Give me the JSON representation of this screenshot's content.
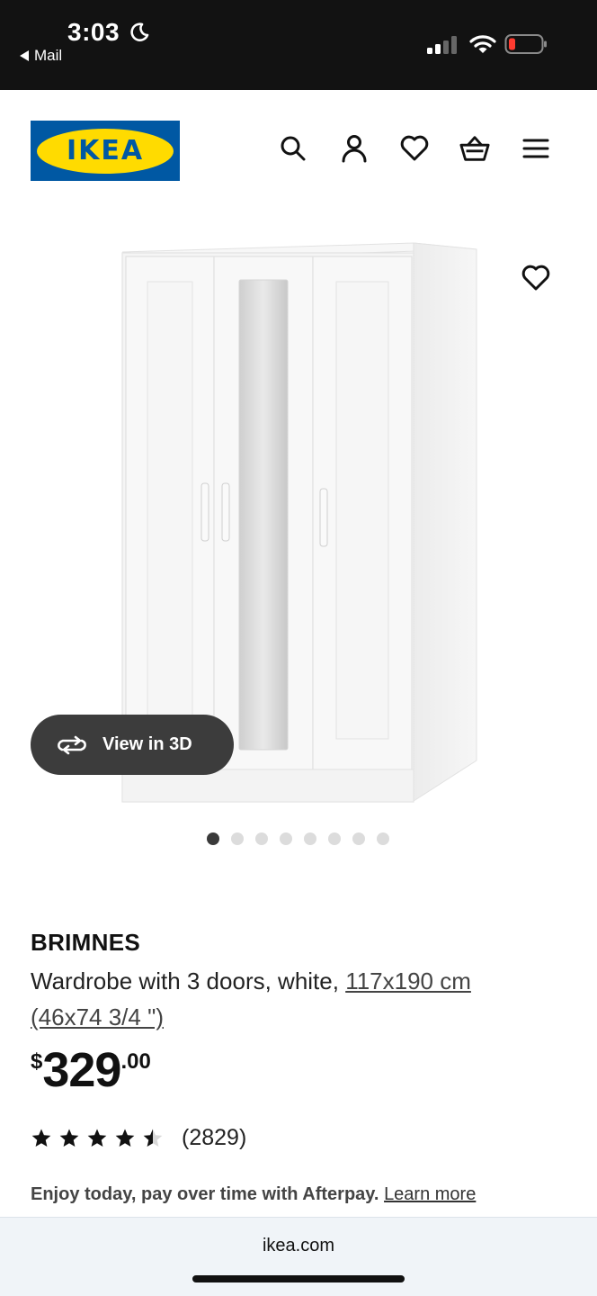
{
  "status_bar": {
    "time": "3:03",
    "back_app": "Mail"
  },
  "header": {
    "logo_text": "IKEA",
    "icons": [
      "search-icon",
      "account-icon",
      "heart-icon",
      "basket-icon",
      "menu-icon"
    ]
  },
  "gallery": {
    "view3d_label": "View in 3D",
    "dot_count": 8,
    "active_dot": 1
  },
  "product": {
    "name": "BRIMNES",
    "description_prefix": "Wardrobe with 3 doors, white, ",
    "dimensions_cm": "117x190 cm",
    "dimensions_in": "(46x74 3/4 \")",
    "price_currency": "$",
    "price_integer": "329",
    "price_decimal": ".00",
    "rating_value": 4.5,
    "review_count": "(2829)"
  },
  "afterpay": {
    "text": "Enjoy today, pay over time with Afterpay.",
    "link": "Learn more"
  },
  "browser": {
    "url": "ikea.com"
  },
  "colors": {
    "ikea_blue": "#0058a3",
    "ikea_yellow": "#ffdb00",
    "status_bar_bg": "#121212",
    "button_dark": "#3c3c3c"
  }
}
